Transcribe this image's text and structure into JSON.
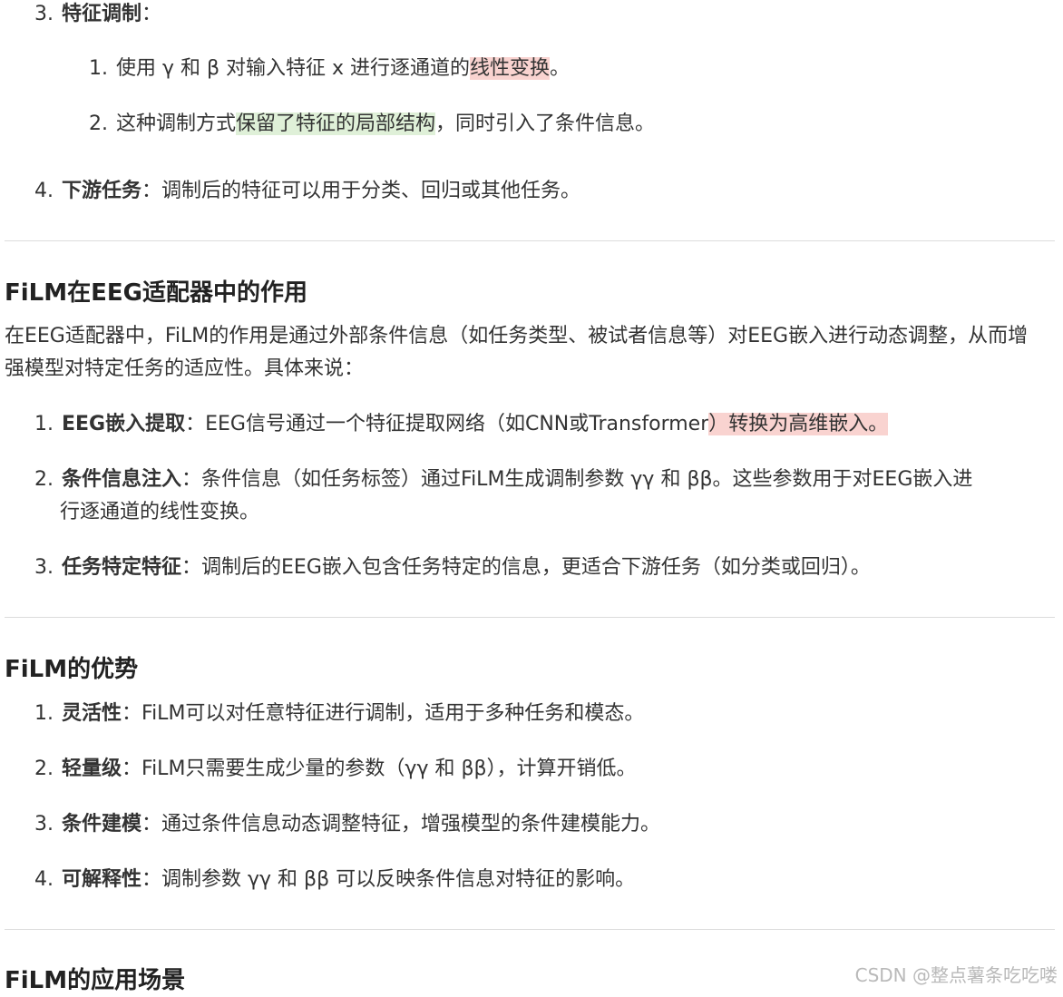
{
  "section_modulation": {
    "item3": {
      "num": "3.",
      "title": "特征调制",
      "sep": "："
    },
    "sub1": {
      "num": "1.",
      "pre": "使用 γ 和 β 对输入特征 x 进行逐通道的",
      "hl": "线性变换",
      "post": "。"
    },
    "sub2": {
      "num": "2.",
      "pre": "这种调制方式",
      "hl": "保留了特征的局部结构",
      "post": "，同时引入了条件信息。"
    },
    "item4": {
      "num": "4.",
      "title": "下游任务",
      "text": "：调制后的特征可以用于分类、回归或其他任务。"
    }
  },
  "section_eeg": {
    "heading": "FiLM在EEG适配器中的作用",
    "intro": "在EEG适配器中，FiLM的作用是通过外部条件信息（如任务类型、被试者信息等）对EEG嵌入进行动态调整，从而增强模型对特定任务的适应性。具体来说：",
    "items": [
      {
        "num": "1.",
        "title": "EEG嵌入提取",
        "pre": "：EEG信号通过一个特征提取网络（如CNN或Transformer",
        "hl": "）转换为高维嵌入。"
      },
      {
        "num": "2.",
        "title": "条件信息注入",
        "text": "：条件信息（如任务标签）通过FiLM生成调制参数 γγ 和 ββ。这些参数用于对EEG嵌入进",
        "text2": "行逐通道的线性变换。"
      },
      {
        "num": "3.",
        "title": "任务特定特征",
        "text": "：调制后的EEG嵌入包含任务特定的信息，更适合下游任务（如分类或回归）。"
      }
    ]
  },
  "section_adv": {
    "heading": "FiLM的优势",
    "items": [
      {
        "num": "1.",
        "title": "灵活性",
        "text": "：FiLM可以对任意特征进行调制，适用于多种任务和模态。"
      },
      {
        "num": "2.",
        "title": "轻量级",
        "text": "：FiLM只需要生成少量的参数（γγ 和 ββ），计算开销低。"
      },
      {
        "num": "3.",
        "title": "条件建模",
        "text": "：通过条件信息动态调整特征，增强模型的条件建模能力。"
      },
      {
        "num": "4.",
        "title": "可解释性",
        "text": "：调制参数 γγ 和 ββ 可以反映条件信息对特征的影响。"
      }
    ]
  },
  "section_app": {
    "heading": "FiLM的应用场景"
  },
  "watermark": "CSDN @整点薯条吃吃喽",
  "colors": {
    "highlight_red": "#f9d3d0",
    "highlight_green": "#dff0d8",
    "divider": "#dcdcdc"
  }
}
